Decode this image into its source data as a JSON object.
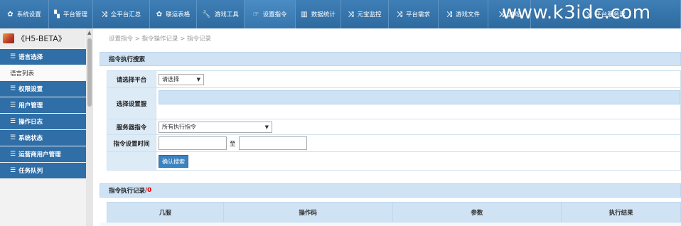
{
  "nav": {
    "items": [
      {
        "icon": "gear-icon",
        "glyph": "✿",
        "label": "系统设置"
      },
      {
        "icon": "book-icon",
        "glyph": "▚",
        "label": "平台管理"
      },
      {
        "icon": "shuffle-icon",
        "glyph": "⤨",
        "label": "全平台汇总"
      },
      {
        "icon": "gear-icon",
        "glyph": "✿",
        "label": "联运表格"
      },
      {
        "icon": "wrench-icon",
        "glyph": "🔧",
        "label": "游戏工具"
      },
      {
        "icon": "hand-point-icon",
        "glyph": "☞",
        "label": "设置指令"
      },
      {
        "icon": "bar-chart-icon",
        "glyph": "▥",
        "label": "数据统计"
      },
      {
        "icon": "shuffle-icon",
        "glyph": "⤨",
        "label": "元宝监控"
      },
      {
        "icon": "shuffle-icon",
        "glyph": "⤨",
        "label": "平台需求"
      },
      {
        "icon": "shuffle-icon",
        "glyph": "⤨",
        "label": "游戏文件"
      },
      {
        "icon": "shuffle-icon",
        "glyph": "⤨",
        "label": "游戏"
      },
      {
        "icon": "shuffle-icon",
        "glyph": "⤨",
        "label": "平台服务器"
      }
    ],
    "watermark": "www.k3idc.com"
  },
  "sidebar": {
    "title": "《H5-BETA》",
    "items": [
      {
        "label": "语言选择",
        "type": "header"
      },
      {
        "label": "语言列表",
        "type": "sub"
      },
      {
        "label": "权限设置",
        "type": "header"
      },
      {
        "label": "用户管理",
        "type": "header"
      },
      {
        "label": "操作日志",
        "type": "header"
      },
      {
        "label": "系统状态",
        "type": "header"
      },
      {
        "label": "运营商用户管理",
        "type": "header"
      },
      {
        "label": "任务队列",
        "type": "header"
      }
    ]
  },
  "breadcrumb": "设置指令 > 指令操作记录 > 指令记录",
  "search": {
    "title": "指令执行搜索",
    "platform_label": "请选择平台",
    "platform_value": "请选择",
    "server_label": "选择设置服",
    "command_label": "服务器指令",
    "command_value": "所有执行指令",
    "time_label": "指令设置时间",
    "time_to": "至",
    "confirm_label": "确认搜索"
  },
  "records": {
    "title": "指令执行记录",
    "count": "/0",
    "columns": [
      "几服",
      "操作码",
      "参数",
      "执行结果"
    ]
  }
}
